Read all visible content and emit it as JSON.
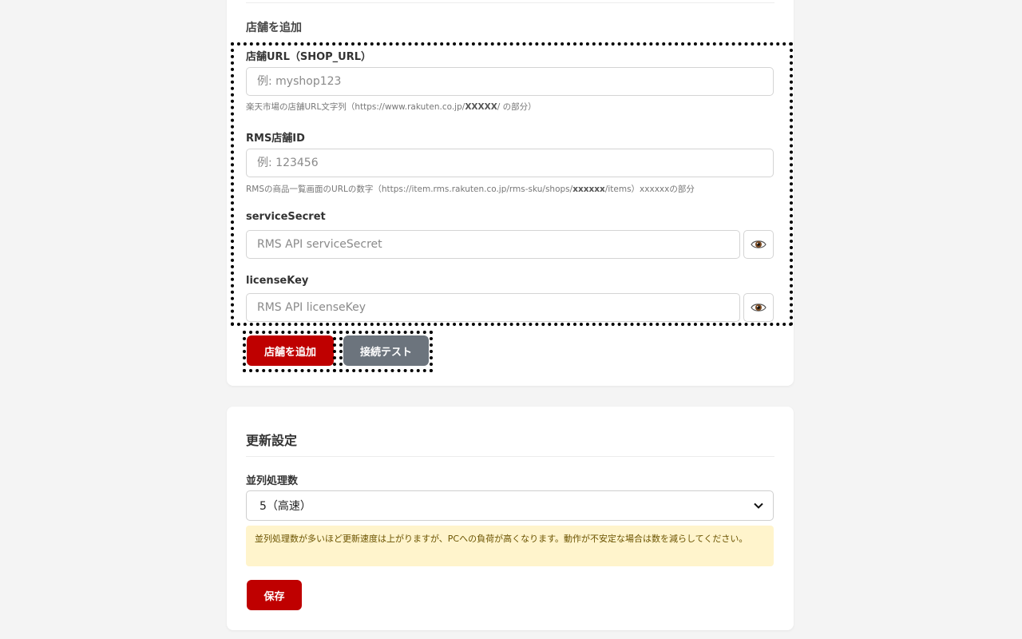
{
  "add_shop": {
    "heading": "店舗を追加",
    "shop_url": {
      "label": "店舗URL（SHOP_URL）",
      "placeholder": "例: myshop123",
      "hint_prefix": "楽天市場の店舗URL文字列（https://www.rakuten.co.jp/",
      "hint_bold": "XXXXX",
      "hint_suffix": "/ の部分）"
    },
    "rms_id": {
      "label": "RMS店舗ID",
      "placeholder": "例: 123456",
      "hint_prefix": "RMSの商品一覧画面のURLの数字（https://item.rms.rakuten.co.jp/rms-sku/shops/",
      "hint_bold": "xxxxxx",
      "hint_suffix": "/items）xxxxxxの部分"
    },
    "service_secret": {
      "label": "serviceSecret",
      "placeholder": "RMS API serviceSecret"
    },
    "license_key": {
      "label": "licenseKey",
      "placeholder": "RMS API licenseKey"
    },
    "add_button": "店舗を追加",
    "test_button": "接続テスト"
  },
  "update_settings": {
    "title": "更新設定",
    "concurrency_label": "並列処理数",
    "concurrency_selected": "5（高速）",
    "notice": "並列処理数が多いほど更新速度は上がりますが、PCへの負荷が高くなります。動作が不安定な場合は数を減らしてください。",
    "save_button": "保存"
  },
  "icons": {
    "toggle_visibility": "eye-icon",
    "select_arrow": "chevron-down-icon"
  },
  "colors": {
    "primary": "#bf0000",
    "secondary": "#6c747d",
    "notice_bg": "#fff4cc",
    "page_bg": "#f4f4f4"
  }
}
